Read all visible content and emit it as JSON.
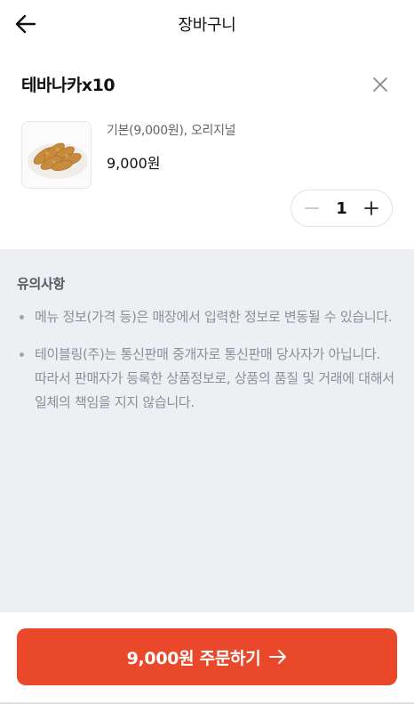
{
  "header": {
    "title": "장바구니",
    "back_icon": "arrow-left-icon"
  },
  "cart_item": {
    "name": "테바나카x10",
    "remove_icon": "close-icon",
    "thumbnail_icon": "fried-chicken-wings-photo",
    "option": "기본(9,000원), 오리지널",
    "price": "9,000원",
    "quantity": "1",
    "minus_icon": "minus-icon",
    "plus_icon": "plus-icon"
  },
  "notice": {
    "title": "유의사항",
    "items": [
      "메뉴 정보(가격 등)은 매장에서 입력한 정보로 변동될 수 있습니다.",
      "테이블링(주)는 통신판매 중개자로 통신판매 당사자가 아닙니다. 따라서 판매자가 등록한 상품정보로, 상품의 품질 및 거래에 대해서 일체의 책임을 지지 않습니다."
    ]
  },
  "order_button": {
    "label": "9,000원 주문하기",
    "icon": "arrow-right-icon"
  },
  "colors": {
    "accent": "#e9492a",
    "notice_bg": "#eeeff3"
  }
}
